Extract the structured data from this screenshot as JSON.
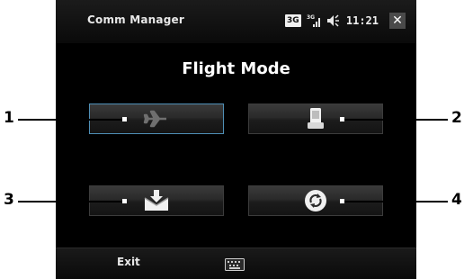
{
  "titlebar": {
    "app_title": "Comm Manager",
    "network_badge": "3G",
    "time": "11:21",
    "close_symbol": "✕",
    "signal_icon": "signal-bars-icon",
    "volume_icon": "speaker-icon"
  },
  "main": {
    "title": "Flight Mode",
    "buttons": [
      {
        "icon": "airplane-icon",
        "state": "selected"
      },
      {
        "icon": "phone-icon",
        "state": "normal"
      },
      {
        "icon": "mail-sync-icon",
        "state": "normal"
      },
      {
        "icon": "sync-icon",
        "state": "normal"
      }
    ]
  },
  "softkeys": {
    "left": "Exit",
    "center_icon": "keyboard-icon"
  },
  "callouts": {
    "one": "1",
    "two": "2",
    "three": "3",
    "four": "4"
  },
  "colors": {
    "screen_bg": "#000000",
    "selected_border": "#4f8fb6",
    "text": "#ffffff"
  }
}
